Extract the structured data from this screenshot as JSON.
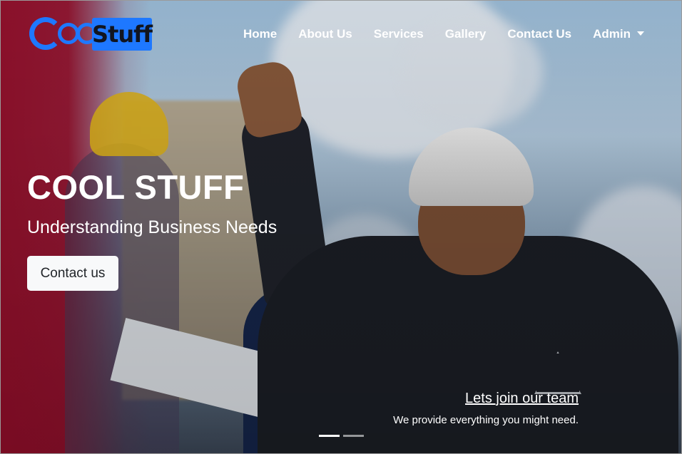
{
  "logo": {
    "part1": "Cool",
    "part2": "Stuff",
    "accent": "#1e78ff"
  },
  "nav": {
    "items": [
      {
        "label": "Home"
      },
      {
        "label": "About Us"
      },
      {
        "label": "Services"
      },
      {
        "label": "Gallery"
      },
      {
        "label": "Contact Us"
      }
    ],
    "dropdown_label": "Admin"
  },
  "hero": {
    "title": "COOL STUFF",
    "subtitle": "Understanding Business Needs",
    "cta_label": "Contact us",
    "overlay_color": "#960c28"
  },
  "caption": {
    "title": "Lets join our team",
    "text": "We provide everything you might need."
  },
  "carousel": {
    "slides": 2,
    "active": 1
  }
}
